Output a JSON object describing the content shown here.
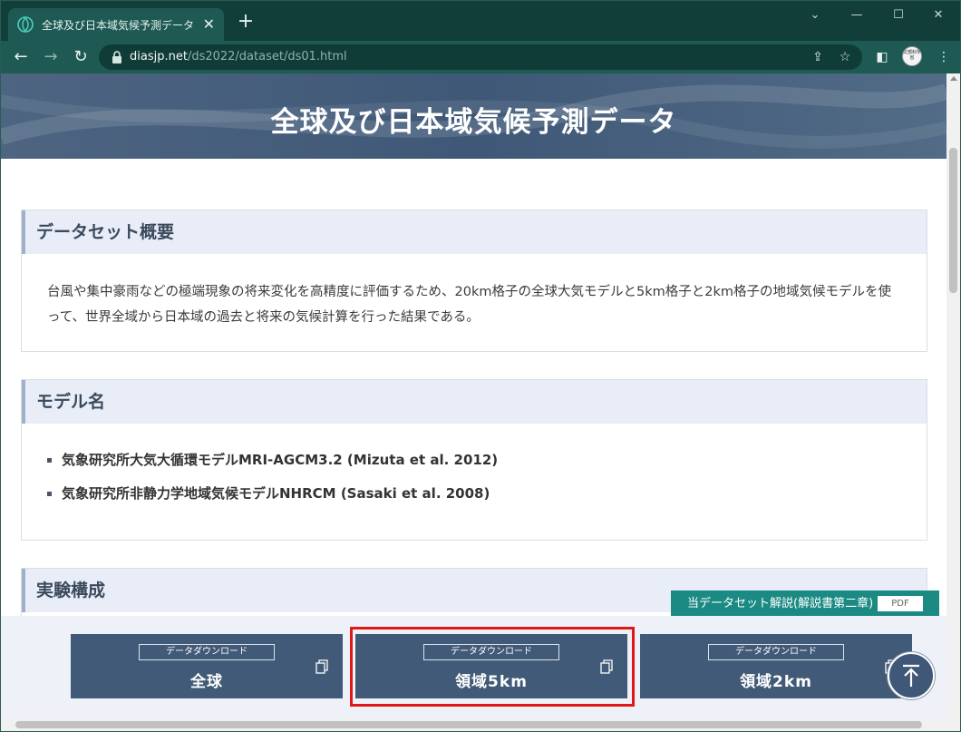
{
  "browser": {
    "tab_title": "全球及び日本域気候予測データ | D",
    "close_glyph": "✕",
    "new_tab_glyph": "+",
    "url_host": "diasjp.net",
    "url_path": "/ds2022/dataset/ds01.html",
    "avatar_text": "文部科学省"
  },
  "page": {
    "hero_title": "全球及び日本域気候予測データ",
    "overview": {
      "heading": "データセット概要",
      "text": "台風や集中豪雨などの極端現象の将来変化を高精度に評価するため、20km格子の全球大気モデルと5km格子と2km格子の地域気候モデルを使って、世界全域から日本域の過去と将来の気候計算を行った結果である。"
    },
    "models": {
      "heading": "モデル名",
      "items": [
        "気象研究所大気大循環モデルMRI-AGCM3.2 (Mizuta et al. 2012)",
        "気象研究所非静力学地域気候モデルNHRCM (Sasaki et al. 2008)"
      ]
    },
    "experiment": {
      "heading": "実験構成"
    },
    "pdf_link": {
      "label": "当データセット解説(解説書第二章)",
      "tag": "PDF"
    },
    "downloads": [
      {
        "tag": "データダウンロード",
        "label": "全球"
      },
      {
        "tag": "データダウンロード",
        "label": "領域5km"
      },
      {
        "tag": "データダウンロード",
        "label": "領域2km"
      }
    ]
  },
  "colors": {
    "accent": "#415a77",
    "highlight": "#e01818",
    "pdf": "#1b8a83"
  }
}
